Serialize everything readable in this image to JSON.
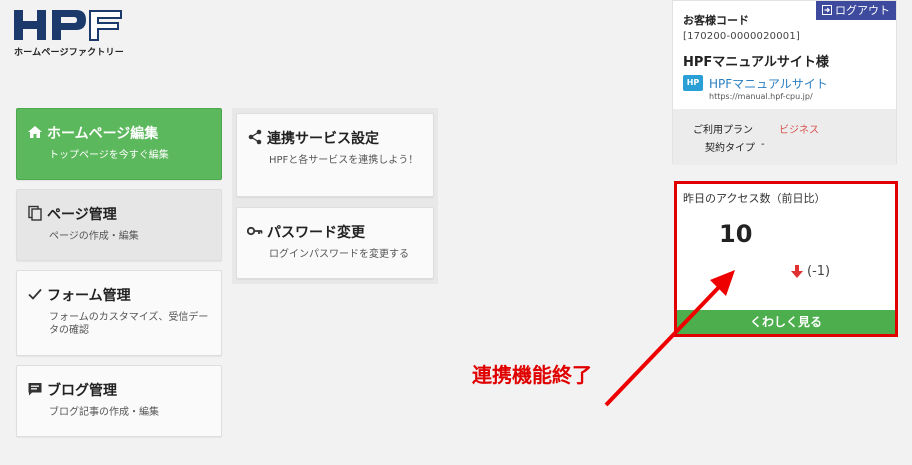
{
  "logo": {
    "mark": "HPF",
    "text": "ホームページファクトリー"
  },
  "menu": [
    {
      "title": "ホームページ編集",
      "subtitle": "トップページを今すぐ編集",
      "icon": "home-icon"
    },
    {
      "title": "ページ管理",
      "subtitle": "ページの作成・編集",
      "icon": "copy-icon"
    },
    {
      "title": "フォーム管理",
      "subtitle": "フォームのカスタマイズ、受信データの確認",
      "icon": "check-icon"
    },
    {
      "title": "ブログ管理",
      "subtitle": "ブログ記事の作成・編集",
      "icon": "comment-icon"
    }
  ],
  "menu2": [
    {
      "title": "連携サービス設定",
      "subtitle": "HPFと各サービスを連携しよう！",
      "icon": "share-icon"
    },
    {
      "title": "パスワード変更",
      "subtitle": "ログインパスワードを変更する",
      "icon": "key-icon"
    }
  ],
  "account": {
    "customer_code_label": "お客様コード",
    "logout_label": "ログアウト",
    "customer_code": "[170200-0000020001]",
    "name": "HPFマニュアルサイト様",
    "site_badge": "HP",
    "site_name": "HPFマニュアルサイト",
    "site_url": "https://manual.hpf-cpu.jp/",
    "plan_label": "ご利用プラン",
    "plan_value": "ビジネス",
    "contract_label": "契約タイプ",
    "contract_value": "-"
  },
  "access": {
    "title": "昨日のアクセス数（前日比）",
    "count": "10",
    "diff": "(-1)",
    "button": "くわしく見る"
  },
  "annotation": {
    "text": "連携機能終了"
  },
  "colors": {
    "green": "#5cb85c",
    "highlight_red": "#e00000",
    "logout_blue": "#3d4a9e",
    "link_blue": "#2a7fc1"
  }
}
